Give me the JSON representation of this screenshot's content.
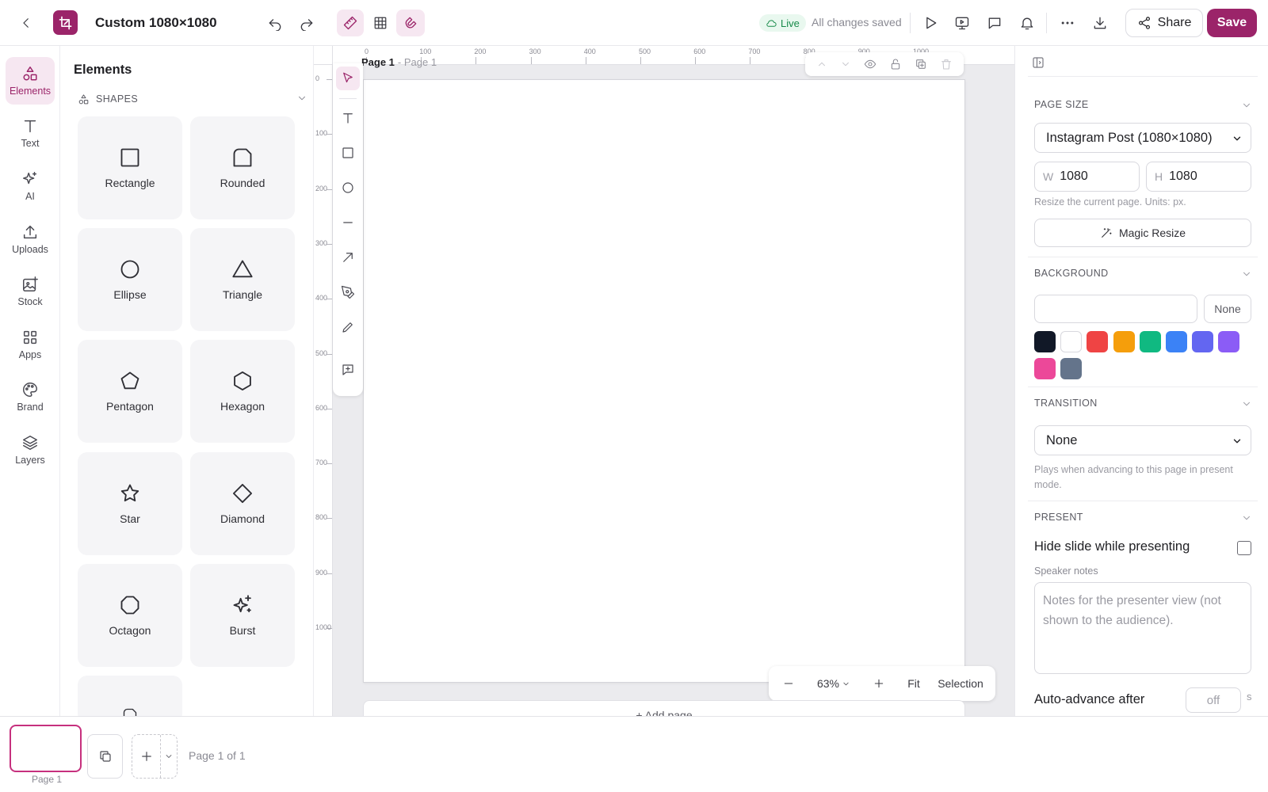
{
  "header": {
    "doc_title": "Custom 1080×1080",
    "live_label": "Live",
    "save_status": "All changes saved",
    "share_label": "Share",
    "save_label": "Save"
  },
  "rail": {
    "items": [
      {
        "label": "Elements",
        "icon": "shapes-icon",
        "active": true
      },
      {
        "label": "Text",
        "icon": "text-icon"
      },
      {
        "label": "AI",
        "icon": "sparkle-icon"
      },
      {
        "label": "Uploads",
        "icon": "upload-icon"
      },
      {
        "label": "Stock",
        "icon": "image-plus-icon"
      },
      {
        "label": "Apps",
        "icon": "grid-icon"
      },
      {
        "label": "Brand",
        "icon": "palette-icon"
      },
      {
        "label": "Layers",
        "icon": "layers-icon"
      }
    ]
  },
  "elements_panel": {
    "title": "Elements",
    "section_label": "SHAPES",
    "shapes": [
      "Rectangle",
      "Rounded",
      "Ellipse",
      "Triangle",
      "Pentagon",
      "Hexagon",
      "Star",
      "Diamond",
      "Octagon",
      "Burst"
    ]
  },
  "canvas": {
    "page_name": "Page 1",
    "page_sub": "- Page 1",
    "ruler_top": [
      "0",
      "100",
      "200",
      "300",
      "400",
      "500",
      "600",
      "700",
      "800",
      "900",
      "1000"
    ],
    "ruler_left": [
      "0",
      "100",
      "200",
      "300",
      "400",
      "500",
      "600",
      "700",
      "800",
      "900",
      "1000"
    ],
    "zoom_level": "63%",
    "fit_label": "Fit",
    "selection_label": "Selection",
    "add_page_label": "+ Add page"
  },
  "properties": {
    "page_size_title": "PAGE SIZE",
    "page_size_value": "Instagram Post (1080×1080)",
    "width_label": "W",
    "width_value": "1080",
    "height_label": "H",
    "height_value": "1080",
    "resize_hint": "Resize the current page. Units: px.",
    "magic_resize_label": "Magic Resize",
    "background_title": "BACKGROUND",
    "background_value": "",
    "background_none_label": "None",
    "swatches": [
      "#111827",
      "#ffffff",
      "#ef4444",
      "#f59e0b",
      "#10b981",
      "#3b82f6",
      "#6366f1",
      "#8b5cf6",
      "#ec4899",
      "#64748b"
    ],
    "transition_title": "TRANSITION",
    "transition_value": "None",
    "transition_hint": "Plays when advancing to this page in present mode.",
    "present_title": "PRESENT",
    "hide_slide_label": "Hide slide while presenting",
    "speaker_notes_label": "Speaker notes",
    "speaker_notes_placeholder": "Notes for the presenter view (not shown to the audience).",
    "auto_advance_label": "Auto-advance after",
    "auto_advance_value": "off",
    "auto_advance_unit": "s"
  },
  "bottom": {
    "thumb_label": "Page 1",
    "page_counter": "Page 1 of 1"
  },
  "colors": {
    "accent": "#9b2469",
    "accent_soft": "#f6e7f1",
    "live_green": "#178a49"
  }
}
